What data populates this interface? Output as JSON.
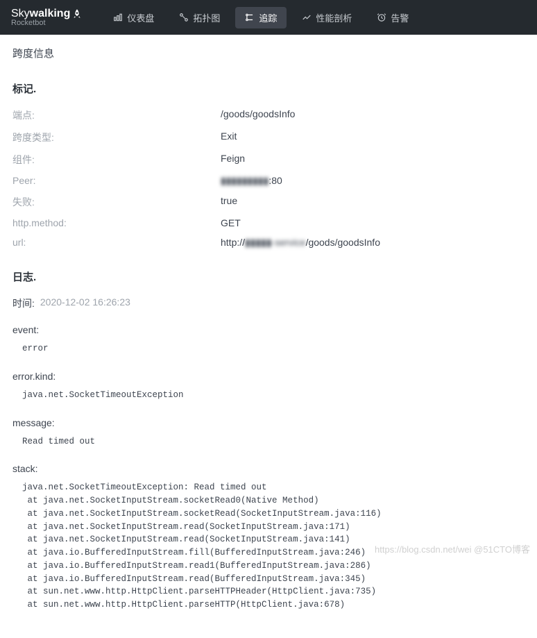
{
  "brand": {
    "name_part1": "Sky",
    "name_part2": "walking",
    "sub": "Rocketbot"
  },
  "nav": [
    {
      "label": "仪表盘",
      "icon": "dashboard-icon"
    },
    {
      "label": "拓扑图",
      "icon": "topology-icon"
    },
    {
      "label": "追踪",
      "icon": "trace-icon",
      "active": true
    },
    {
      "label": "性能剖析",
      "icon": "profile-icon"
    },
    {
      "label": "告警",
      "icon": "alarm-icon"
    }
  ],
  "page_title": "跨度信息",
  "tags": {
    "heading": "标记.",
    "rows": [
      {
        "key": "端点:",
        "val": "/goods/goodsInfo"
      },
      {
        "key": "跨度类型:",
        "val": "Exit"
      },
      {
        "key": "组件:",
        "val": "Feign"
      },
      {
        "key": "Peer:",
        "val_prefix": "",
        "val_blur": "▮▮▮▮▮▮▮▮▮",
        "val_suffix": ":80"
      },
      {
        "key": "失败:",
        "val": "true"
      },
      {
        "key": "http.method:",
        "val": "GET"
      },
      {
        "key": "url:",
        "val_prefix": "http://",
        "val_blur": "▮▮▮▮▮-service",
        "val_suffix": "/goods/goodsInfo"
      }
    ]
  },
  "logs": {
    "heading": "日志.",
    "time_label": "时间:",
    "time_val": "2020-12-02 16:26:23",
    "fields": [
      {
        "name": "event:",
        "val": "error"
      },
      {
        "name": "error.kind:",
        "val": "java.net.SocketTimeoutException"
      },
      {
        "name": "message:",
        "val": "Read timed out"
      },
      {
        "name": "stack:",
        "val": "java.net.SocketTimeoutException: Read timed out\n at java.net.SocketInputStream.socketRead0(Native Method)\n at java.net.SocketInputStream.socketRead(SocketInputStream.java:116)\n at java.net.SocketInputStream.read(SocketInputStream.java:171)\n at java.net.SocketInputStream.read(SocketInputStream.java:141)\n at java.io.BufferedInputStream.fill(BufferedInputStream.java:246)\n at java.io.BufferedInputStream.read1(BufferedInputStream.java:286)\n at java.io.BufferedInputStream.read(BufferedInputStream.java:345)\n at sun.net.www.http.HttpClient.parseHTTPHeader(HttpClient.java:735)\n at sun.net.www.http.HttpClient.parseHTTP(HttpClient.java:678)"
      }
    ]
  },
  "watermark": "https://blog.csdn.net/wei  @51CTO博客"
}
